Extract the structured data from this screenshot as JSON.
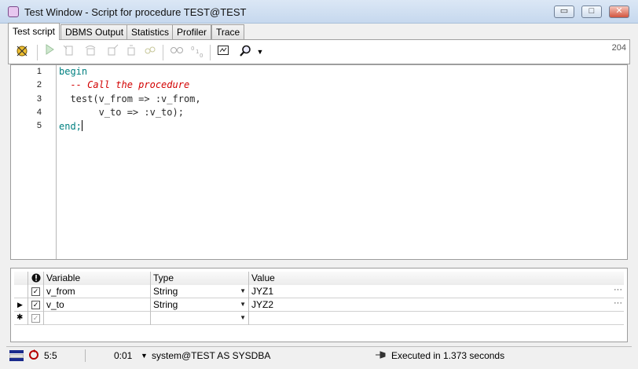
{
  "window": {
    "title": "Test Window - Script for procedure TEST@TEST",
    "minimize_glyph": "▭",
    "maximize_glyph": "□",
    "close_glyph": "✕"
  },
  "tabs": [
    {
      "label": "Test script",
      "active": true
    },
    {
      "label": "DBMS Output"
    },
    {
      "label": "Statistics"
    },
    {
      "label": "Profiler"
    },
    {
      "label": "Trace"
    }
  ],
  "toolbar": {
    "counter": "204",
    "icons": [
      "debug-start-icon",
      "execute-icon",
      "step-into-icon",
      "step-over-icon",
      "step-out-icon",
      "run-to-exception-icon",
      "toggle-watches-icon",
      "toggle-values-icon",
      "dbms-output-icon",
      "find-icon",
      "dropdown-icon"
    ]
  },
  "editor": {
    "line_numbers": [
      "1",
      "2",
      "3",
      "4",
      "5"
    ],
    "lines": {
      "l1_kw": "begin",
      "l2_comment": "-- Call the procedure",
      "l3_code": "test(v_from => :v_from,",
      "l4_code": "v_to => :v_to);",
      "l5_kw": "end;"
    }
  },
  "variables": {
    "headers": {
      "variable": "Variable",
      "type": "Type",
      "value": "Value"
    },
    "rows": [
      {
        "checked": true,
        "variable": "v_from",
        "type": "String",
        "value": "JYZ1",
        "marker": ""
      },
      {
        "checked": true,
        "variable": "v_to",
        "type": "String",
        "value": "JYZ2",
        "marker": "▶"
      },
      {
        "checked": true,
        "variable": "",
        "type": "",
        "value": "",
        "marker": "✱"
      }
    ]
  },
  "status": {
    "position": "5:5",
    "time": "0:01",
    "connection": "system@TEST AS SYSDBA",
    "message": "Executed in 1.373 seconds"
  },
  "colors": {
    "keyword": "#008080",
    "comment": "#d20000"
  }
}
